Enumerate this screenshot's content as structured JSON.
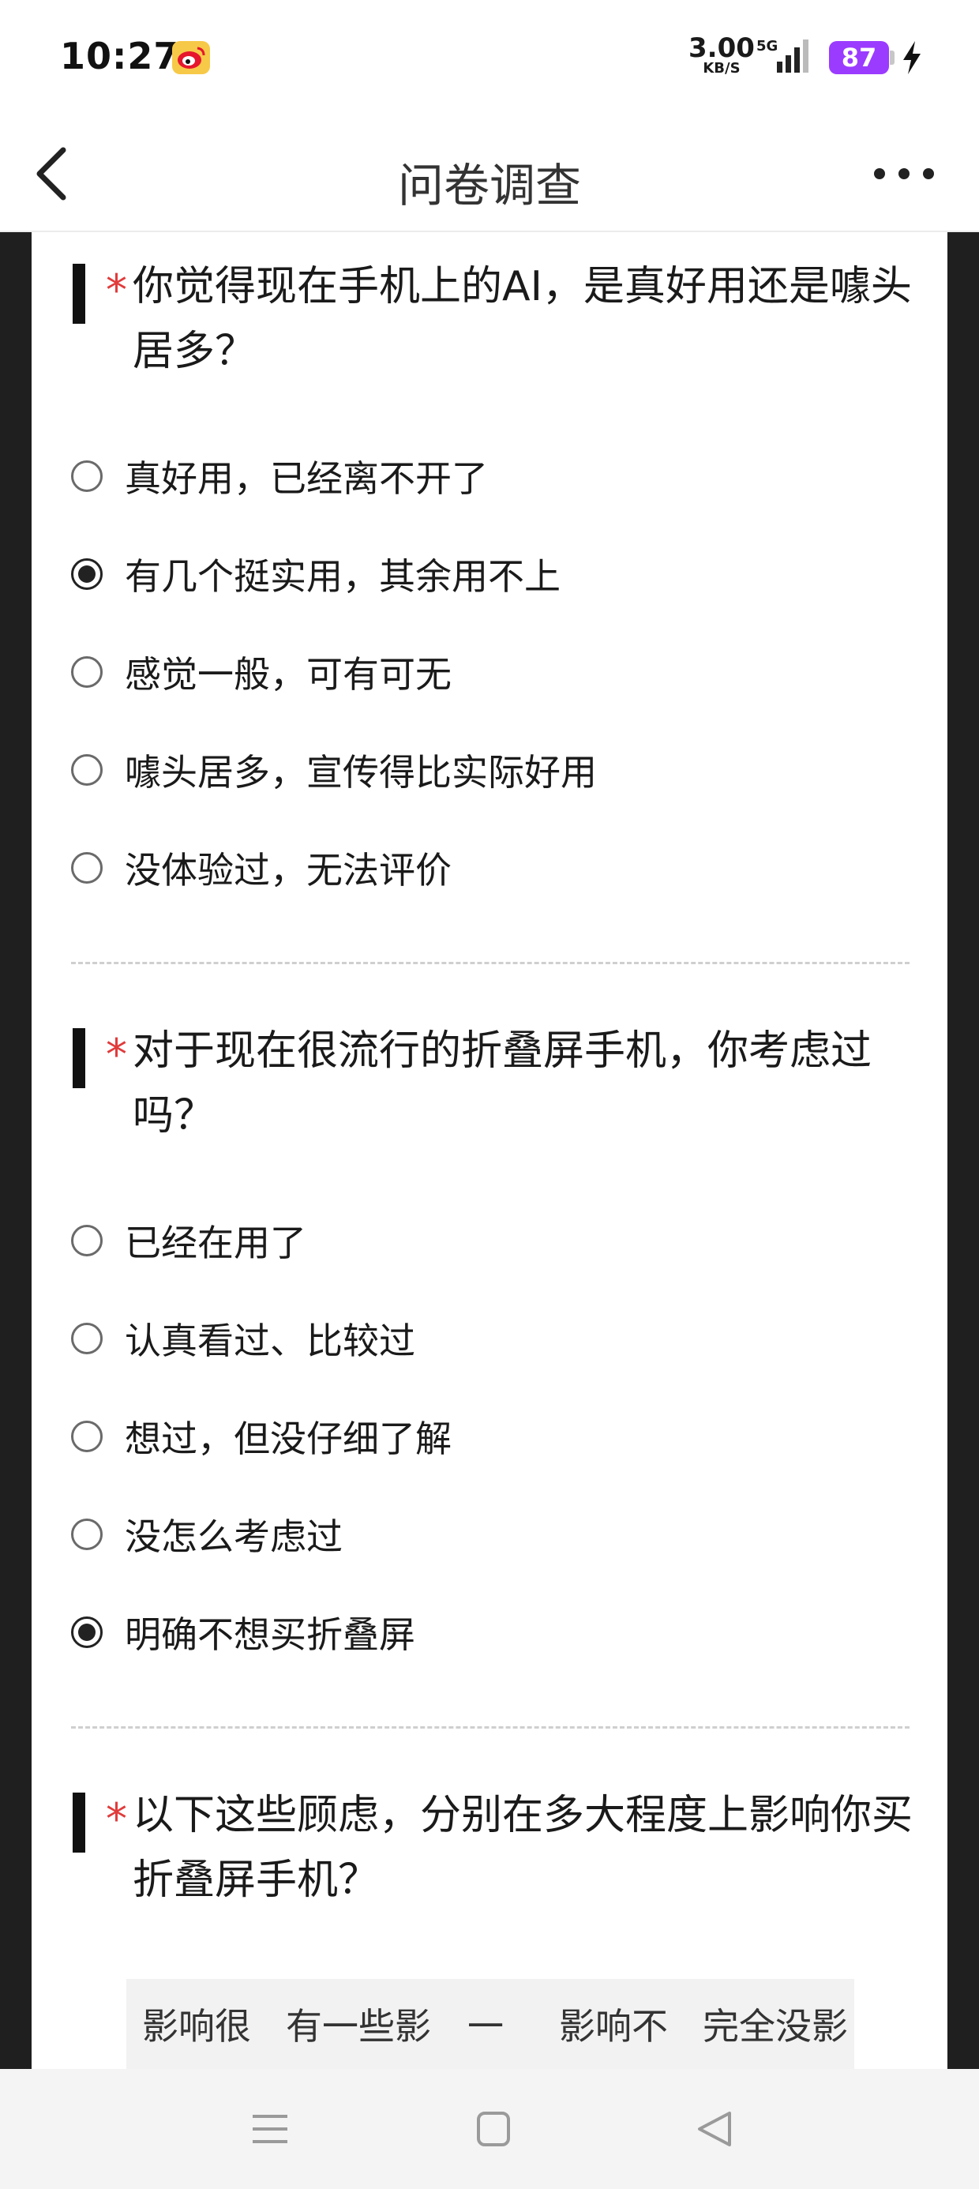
{
  "status_bar": {
    "time": "10:27",
    "weibo_icon": "weibo-icon",
    "net_speed_value": "3.00",
    "net_speed_unit": "KB/S",
    "network_type": "5G",
    "battery": "87"
  },
  "title_bar": {
    "title": "问卷调查"
  },
  "questions": [
    {
      "required_mark": "*",
      "text": "你觉得现在手机上的AI，是真好用还是噱头居多？",
      "options": [
        {
          "label": "真好用，已经离不开了",
          "selected": false
        },
        {
          "label": "有几个挺实用，其余用不上",
          "selected": true
        },
        {
          "label": "感觉一般，可有可无",
          "selected": false
        },
        {
          "label": "噱头居多，宣传得比实际好用",
          "selected": false
        },
        {
          "label": "没体验过，无法评价",
          "selected": false
        }
      ]
    },
    {
      "required_mark": "*",
      "text": "对于现在很流行的折叠屏手机，你考虑过吗？",
      "options": [
        {
          "label": "已经在用了",
          "selected": false
        },
        {
          "label": "认真看过、比较过",
          "selected": false
        },
        {
          "label": "想过，但没仔细了解",
          "selected": false
        },
        {
          "label": "没怎么考虑过",
          "selected": false
        },
        {
          "label": "明确不想买折叠屏",
          "selected": true
        }
      ]
    },
    {
      "required_mark": "*",
      "text": "以下这些顾虑，分别在多大程度上影响你买折叠屏手机？",
      "scale_headers": [
        "影响很",
        "有一些影",
        "一",
        "影响不",
        "完全没影"
      ]
    }
  ],
  "nav_bar": {
    "menu_icon": "menu-icon",
    "home_icon": "home-icon",
    "back_icon": "back-triangle-icon"
  },
  "colors": {
    "required": "#e13b3b",
    "battery": "#9b3bff",
    "side_background": "#1f1f1f"
  }
}
